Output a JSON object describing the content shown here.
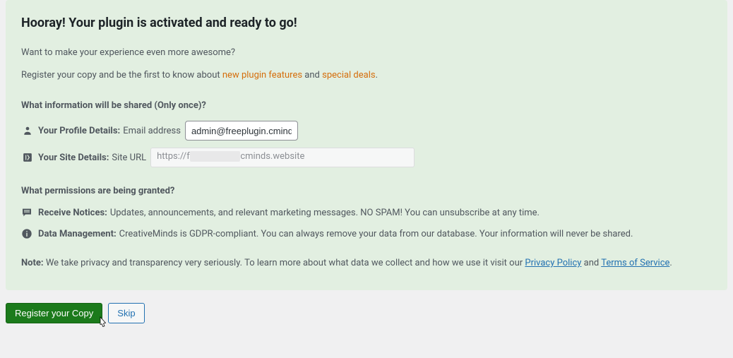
{
  "heading": "Hooray! Your plugin is activated and ready to go!",
  "intro1": "Want to make your experience even more awesome?",
  "intro2_pre": "Register your copy and be the first to know about ",
  "intro2_link1": "new plugin features",
  "intro2_mid": " and ",
  "intro2_link2": "special deals",
  "intro2_post": ".",
  "share": {
    "heading": "What information will be shared (Only once)?",
    "profile_label": "Your Profile Details:",
    "profile_sub": "Email address",
    "profile_value": "admin@freeplugin.cminds.website",
    "site_label": "Your Site Details:",
    "site_sub": "Site URL",
    "site_url_pre": "https://f",
    "site_url_post": "cminds.website"
  },
  "perms": {
    "heading": "What permissions are being granted?",
    "notices_label": "Receive Notices:",
    "notices_text": "Updates, announcements, and relevant marketing messages. NO SPAM! You can unsubscribe at any time.",
    "data_label": "Data Management:",
    "data_text": "CreativeMinds is GDPR-compliant. You can always remove your data from our database. Your information will never be shared."
  },
  "note": {
    "label": "Note:",
    "text_pre": " We take privacy and transparency very seriously. To learn more about what data we collect and how we use it visit our ",
    "privacy": "Privacy Policy",
    "mid": " and ",
    "tos": "Terms of Service",
    "post": "."
  },
  "buttons": {
    "register": "Register your Copy",
    "skip": "Skip"
  }
}
